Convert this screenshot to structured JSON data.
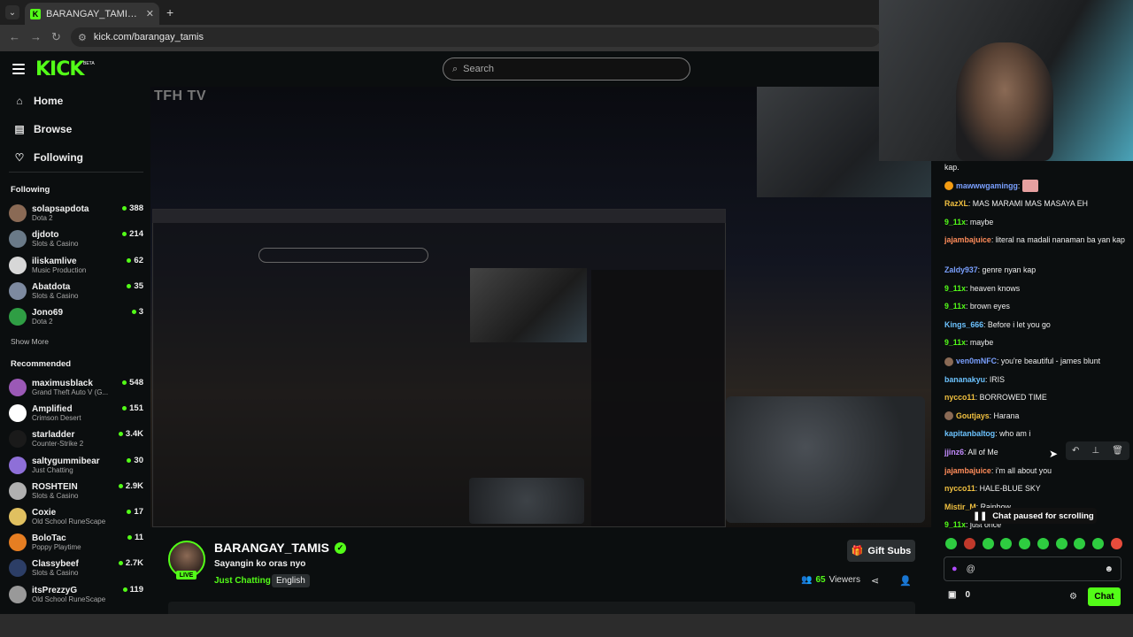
{
  "browser": {
    "tab_title": "BARANGAY_TAMIS Stream - W",
    "url": "kick.com/barangay_tamis"
  },
  "header": {
    "logo": "KICK",
    "beta": "BETA",
    "search_placeholder": "Search"
  },
  "nav": {
    "home": "Home",
    "browse": "Browse",
    "following": "Following"
  },
  "sidebar": {
    "following_title": "Following",
    "show_more": "Show More",
    "recommended_title": "Recommended",
    "following_channels": [
      {
        "name": "solapsapdota",
        "category": "Dota 2",
        "viewers": "388",
        "color": "#8a6a55"
      },
      {
        "name": "djdoto",
        "category": "Slots & Casino",
        "viewers": "214",
        "color": "#6a7a88"
      },
      {
        "name": "iliskamlive",
        "category": "Music Production",
        "viewers": "62",
        "color": "#d7d7d7"
      },
      {
        "name": "Abatdota",
        "category": "Slots & Casino",
        "viewers": "35",
        "color": "#7d8aa0"
      },
      {
        "name": "Jono69",
        "category": "Dota 2",
        "viewers": "3",
        "color": "#2f9e44"
      }
    ],
    "recommended_channels": [
      {
        "name": "maximusblack",
        "category": "Grand Theft Auto V (G...",
        "viewers": "548",
        "color": "#9b59b6"
      },
      {
        "name": "Amplified",
        "category": "Crimson Desert",
        "viewers": "151",
        "color": "#ffffff"
      },
      {
        "name": "starladder",
        "category": "Counter-Strike 2",
        "viewers": "3.4K",
        "color": "#1a1a1a"
      },
      {
        "name": "saltygummibear",
        "category": "Just Chatting",
        "viewers": "30",
        "color": "#8e6fd8"
      },
      {
        "name": "ROSHTEIN",
        "category": "Slots & Casino",
        "viewers": "2.9K",
        "color": "#b0b0b0"
      },
      {
        "name": "Coxie",
        "category": "Old School RuneScape",
        "viewers": "17",
        "color": "#e0c060"
      },
      {
        "name": "BoloTac",
        "category": "Poppy Playtime",
        "viewers": "11",
        "color": "#e67e22"
      },
      {
        "name": "Classybeef",
        "category": "Slots & Casino",
        "viewers": "2.7K",
        "color": "#2c3e66"
      },
      {
        "name": "itsPrezzyG",
        "category": "Old School RuneScape",
        "viewers": "119",
        "color": "#999999"
      }
    ]
  },
  "video": {
    "watermark": "TFH TV"
  },
  "chat": {
    "messages": [
      {
        "user": "",
        "text": "kap.",
        "color": "#eeeeee"
      },
      {
        "user": "mawwwgamingg",
        "text": "",
        "color": "#7aa0ff"
      },
      {
        "user": "RazXL",
        "text": "MAS MARAMI MAS MASAYA EH",
        "color": "#f0c040"
      },
      {
        "user": "9_11x",
        "text": "maybe",
        "color": "#53fc18"
      },
      {
        "user": "jajambajuice",
        "text": "literal na madali nanaman ba yan kap",
        "color": "#ff8c5a"
      },
      {
        "user": "Zaldy937",
        "text": "genre nyan kap",
        "color": "#7aa0ff"
      },
      {
        "user": "9_11x",
        "text": "heaven knows",
        "color": "#53fc18"
      },
      {
        "user": "9_11x",
        "text": "brown eyes",
        "color": "#53fc18"
      },
      {
        "user": "Kings_666",
        "text": "Before i let you go",
        "color": "#6cc3ff"
      },
      {
        "user": "9_11x",
        "text": "maybe",
        "color": "#53fc18"
      },
      {
        "user": "ven0mNFC",
        "text": "you're beautiful - james blunt",
        "color": "#7aa0ff"
      },
      {
        "user": "bananakyu",
        "text": "IRIS",
        "color": "#6cc3ff"
      },
      {
        "user": "nycco11",
        "text": "BORROWED TIME",
        "color": "#f0c040"
      },
      {
        "user": "Goutjays",
        "text": "Harana",
        "color": "#f0c040"
      },
      {
        "user": "kapitanbaltog",
        "text": "who am i",
        "color": "#6cc3ff"
      },
      {
        "user": "jjinz6",
        "text": "All of Me",
        "color": "#c48cff"
      },
      {
        "user": "jajambajuice",
        "text": "i'm all about you",
        "color": "#ff8c5a"
      },
      {
        "user": "nycco11",
        "text": "HALE-BLUE SKY",
        "color": "#f0c040"
      },
      {
        "user": "Mistir_M",
        "text": "Rainbow",
        "color": "#f0c040"
      },
      {
        "user": "9_11x",
        "text": "just once",
        "color": "#53fc18"
      }
    ],
    "paused_label": "Chat paused for scrolling",
    "input_value": "@",
    "kicks_count": "0",
    "send_label": "Chat"
  },
  "stream": {
    "streamer": "BARANGAY_TAMIS",
    "live_label": "LIVE",
    "title": "Sayangin ko oras nyo",
    "category": "Just Chatting",
    "language": "English",
    "gift_label": "Gift Subs",
    "viewer_count": "65",
    "viewers_label": "Viewers"
  },
  "colors": {
    "accent": "#53fc18",
    "background": "#0b0e0f"
  }
}
